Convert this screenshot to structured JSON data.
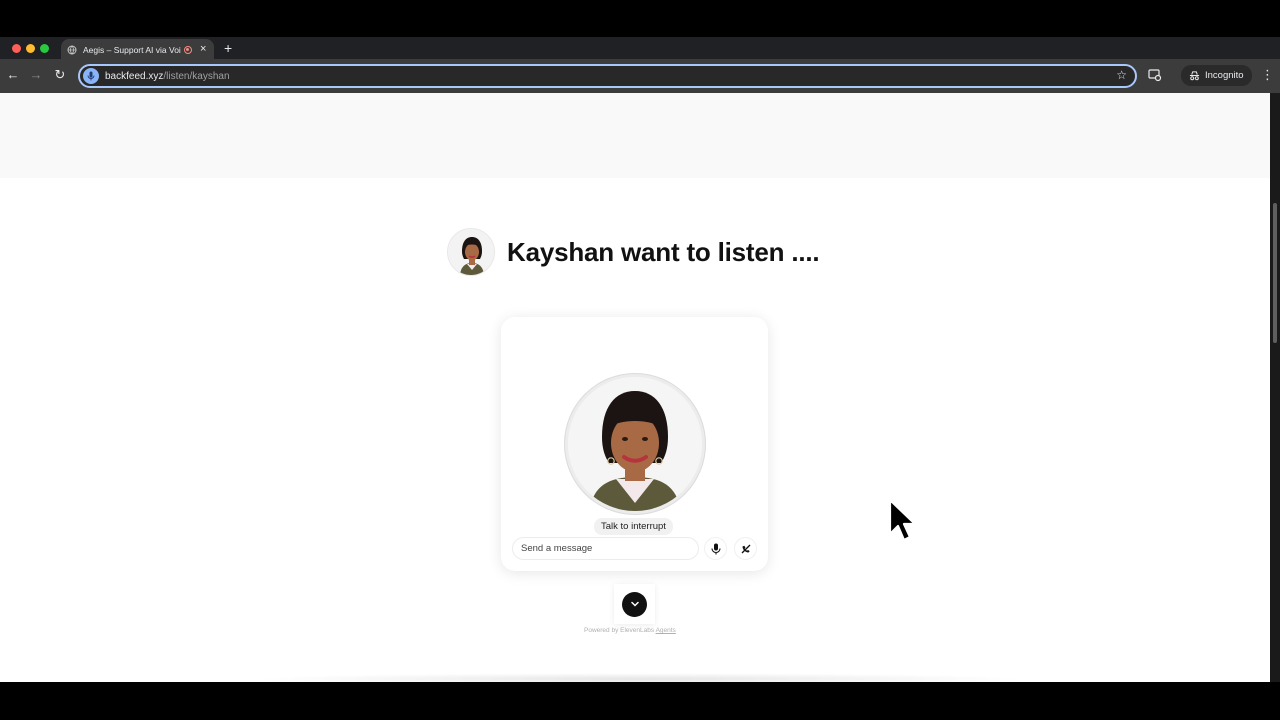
{
  "browser": {
    "tab_title": "Aegis – Support AI via Voi",
    "tab_close": "×",
    "new_tab": "+",
    "url_host": "backfeed.xyz",
    "url_path": "/listen/kayshan",
    "incognito_label": "Incognito",
    "menu_glyph": "⋮",
    "star_glyph": "☆",
    "back_glyph": "←",
    "forward_glyph": "→",
    "reload_glyph": "↻"
  },
  "page": {
    "title": "Kayshan want to listen ....",
    "widget": {
      "status": "Talk to interrupt",
      "input_placeholder": "Send a message"
    },
    "powered_by": {
      "text": "Powered by ElevenLabs ",
      "link": "Agents"
    }
  },
  "colors": {
    "traffic_close": "#ff5f57",
    "traffic_min": "#febc2e",
    "traffic_max": "#28c840",
    "omnibox_focus": "#a8c7fa",
    "title_text": "#111111"
  }
}
